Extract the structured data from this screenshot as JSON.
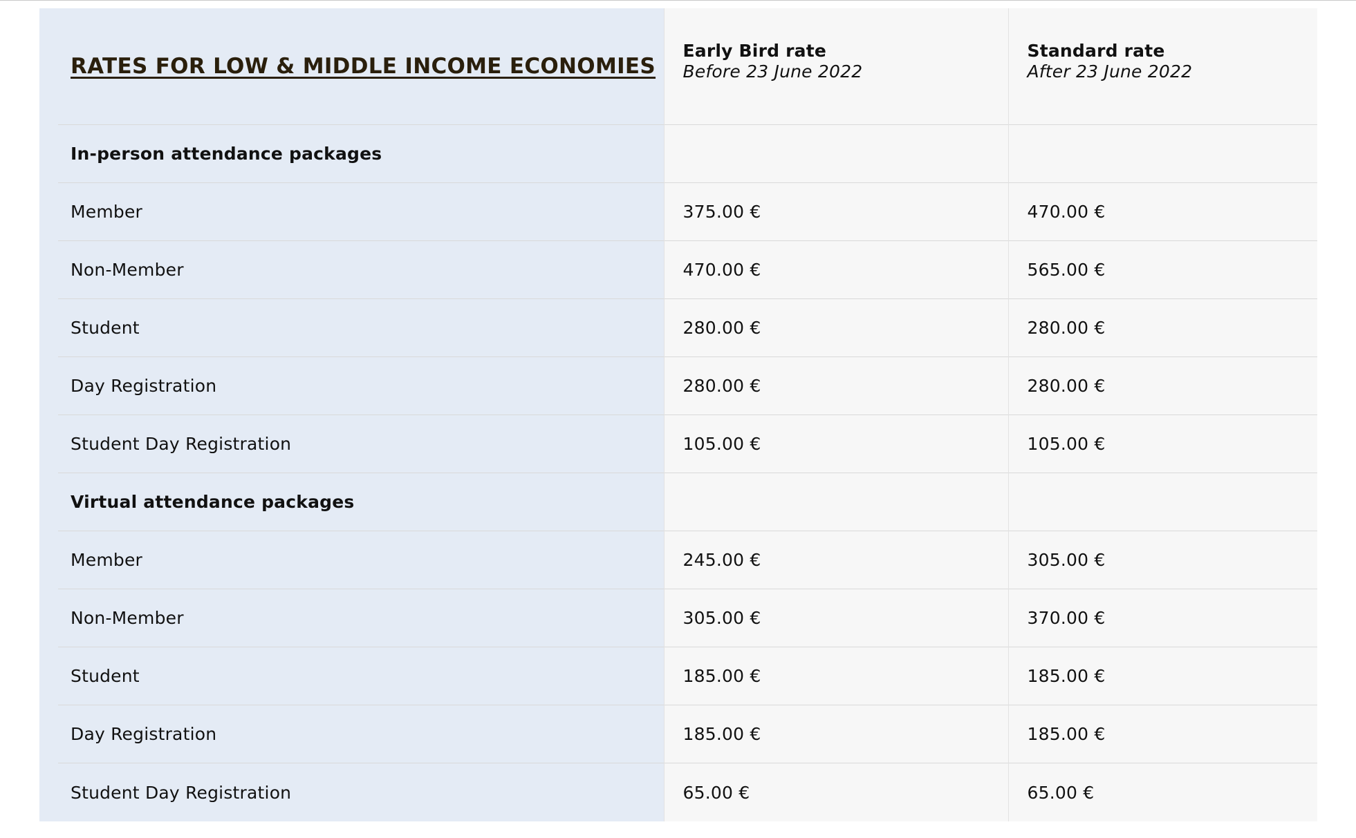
{
  "table": {
    "title": "RATES FOR LOW & MIDDLE INCOME ECONOMIES",
    "columns": [
      {
        "title": "Early Bird rate",
        "subtitle": "Before 23 June 2022"
      },
      {
        "title": "Standard rate",
        "subtitle": "After 23 June 2022"
      }
    ],
    "sections": [
      {
        "label": "In-person attendance packages",
        "rows": [
          {
            "label": "Member",
            "early": "375.00 €",
            "standard": "470.00 €"
          },
          {
            "label": "Non-Member",
            "early": "470.00 €",
            "standard": "565.00 €"
          },
          {
            "label": "Student",
            "early": "280.00 €",
            "standard": "280.00 €"
          },
          {
            "label": "Day Registration",
            "early": "280.00 €",
            "standard": "280.00 €"
          },
          {
            "label": "Student Day Registration",
            "early": "105.00 €",
            "standard": "105.00 €"
          }
        ]
      },
      {
        "label": "Virtual attendance packages",
        "rows": [
          {
            "label": "Member",
            "early": "245.00 €",
            "standard": "305.00 €"
          },
          {
            "label": "Non-Member",
            "early": "305.00 €",
            "standard": "370.00 €"
          },
          {
            "label": "Student",
            "early": "185.00 €",
            "standard": "185.00 €"
          },
          {
            "label": "Day Registration",
            "early": "185.00 €",
            "standard": "185.00 €"
          },
          {
            "label": "Student Day Registration",
            "early": "65.00 €",
            "standard": "65.00 €"
          }
        ]
      }
    ]
  },
  "colors": {
    "label_column_bg": "#e4ebf5",
    "price_column_bg": "#f7f7f7",
    "title_text": "#2a1f0c",
    "row_divider": "#d9d9d9"
  }
}
